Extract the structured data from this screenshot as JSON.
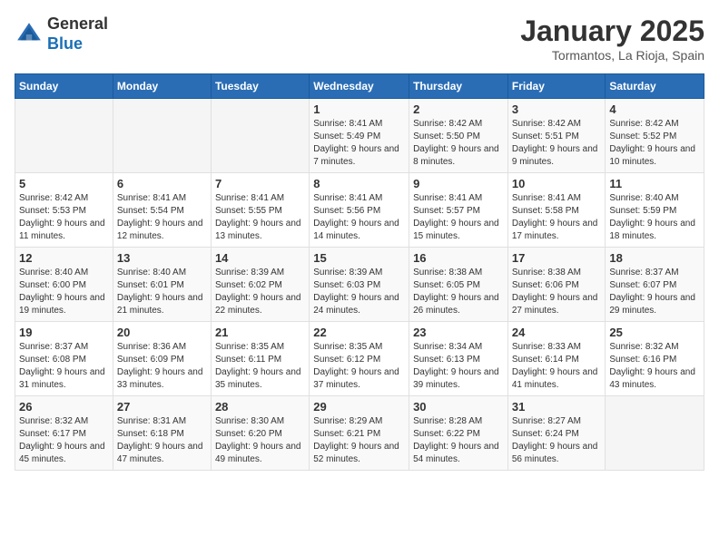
{
  "header": {
    "logo_general": "General",
    "logo_blue": "Blue",
    "month_title": "January 2025",
    "subtitle": "Tormantos, La Rioja, Spain"
  },
  "days_of_week": [
    "Sunday",
    "Monday",
    "Tuesday",
    "Wednesday",
    "Thursday",
    "Friday",
    "Saturday"
  ],
  "weeks": [
    [
      {
        "day": "",
        "info": ""
      },
      {
        "day": "",
        "info": ""
      },
      {
        "day": "",
        "info": ""
      },
      {
        "day": "1",
        "info": "Sunrise: 8:41 AM\nSunset: 5:49 PM\nDaylight: 9 hours and 7 minutes."
      },
      {
        "day": "2",
        "info": "Sunrise: 8:42 AM\nSunset: 5:50 PM\nDaylight: 9 hours and 8 minutes."
      },
      {
        "day": "3",
        "info": "Sunrise: 8:42 AM\nSunset: 5:51 PM\nDaylight: 9 hours and 9 minutes."
      },
      {
        "day": "4",
        "info": "Sunrise: 8:42 AM\nSunset: 5:52 PM\nDaylight: 9 hours and 10 minutes."
      }
    ],
    [
      {
        "day": "5",
        "info": "Sunrise: 8:42 AM\nSunset: 5:53 PM\nDaylight: 9 hours and 11 minutes."
      },
      {
        "day": "6",
        "info": "Sunrise: 8:41 AM\nSunset: 5:54 PM\nDaylight: 9 hours and 12 minutes."
      },
      {
        "day": "7",
        "info": "Sunrise: 8:41 AM\nSunset: 5:55 PM\nDaylight: 9 hours and 13 minutes."
      },
      {
        "day": "8",
        "info": "Sunrise: 8:41 AM\nSunset: 5:56 PM\nDaylight: 9 hours and 14 minutes."
      },
      {
        "day": "9",
        "info": "Sunrise: 8:41 AM\nSunset: 5:57 PM\nDaylight: 9 hours and 15 minutes."
      },
      {
        "day": "10",
        "info": "Sunrise: 8:41 AM\nSunset: 5:58 PM\nDaylight: 9 hours and 17 minutes."
      },
      {
        "day": "11",
        "info": "Sunrise: 8:40 AM\nSunset: 5:59 PM\nDaylight: 9 hours and 18 minutes."
      }
    ],
    [
      {
        "day": "12",
        "info": "Sunrise: 8:40 AM\nSunset: 6:00 PM\nDaylight: 9 hours and 19 minutes."
      },
      {
        "day": "13",
        "info": "Sunrise: 8:40 AM\nSunset: 6:01 PM\nDaylight: 9 hours and 21 minutes."
      },
      {
        "day": "14",
        "info": "Sunrise: 8:39 AM\nSunset: 6:02 PM\nDaylight: 9 hours and 22 minutes."
      },
      {
        "day": "15",
        "info": "Sunrise: 8:39 AM\nSunset: 6:03 PM\nDaylight: 9 hours and 24 minutes."
      },
      {
        "day": "16",
        "info": "Sunrise: 8:38 AM\nSunset: 6:05 PM\nDaylight: 9 hours and 26 minutes."
      },
      {
        "day": "17",
        "info": "Sunrise: 8:38 AM\nSunset: 6:06 PM\nDaylight: 9 hours and 27 minutes."
      },
      {
        "day": "18",
        "info": "Sunrise: 8:37 AM\nSunset: 6:07 PM\nDaylight: 9 hours and 29 minutes."
      }
    ],
    [
      {
        "day": "19",
        "info": "Sunrise: 8:37 AM\nSunset: 6:08 PM\nDaylight: 9 hours and 31 minutes."
      },
      {
        "day": "20",
        "info": "Sunrise: 8:36 AM\nSunset: 6:09 PM\nDaylight: 9 hours and 33 minutes."
      },
      {
        "day": "21",
        "info": "Sunrise: 8:35 AM\nSunset: 6:11 PM\nDaylight: 9 hours and 35 minutes."
      },
      {
        "day": "22",
        "info": "Sunrise: 8:35 AM\nSunset: 6:12 PM\nDaylight: 9 hours and 37 minutes."
      },
      {
        "day": "23",
        "info": "Sunrise: 8:34 AM\nSunset: 6:13 PM\nDaylight: 9 hours and 39 minutes."
      },
      {
        "day": "24",
        "info": "Sunrise: 8:33 AM\nSunset: 6:14 PM\nDaylight: 9 hours and 41 minutes."
      },
      {
        "day": "25",
        "info": "Sunrise: 8:32 AM\nSunset: 6:16 PM\nDaylight: 9 hours and 43 minutes."
      }
    ],
    [
      {
        "day": "26",
        "info": "Sunrise: 8:32 AM\nSunset: 6:17 PM\nDaylight: 9 hours and 45 minutes."
      },
      {
        "day": "27",
        "info": "Sunrise: 8:31 AM\nSunset: 6:18 PM\nDaylight: 9 hours and 47 minutes."
      },
      {
        "day": "28",
        "info": "Sunrise: 8:30 AM\nSunset: 6:20 PM\nDaylight: 9 hours and 49 minutes."
      },
      {
        "day": "29",
        "info": "Sunrise: 8:29 AM\nSunset: 6:21 PM\nDaylight: 9 hours and 52 minutes."
      },
      {
        "day": "30",
        "info": "Sunrise: 8:28 AM\nSunset: 6:22 PM\nDaylight: 9 hours and 54 minutes."
      },
      {
        "day": "31",
        "info": "Sunrise: 8:27 AM\nSunset: 6:24 PM\nDaylight: 9 hours and 56 minutes."
      },
      {
        "day": "",
        "info": ""
      }
    ]
  ]
}
